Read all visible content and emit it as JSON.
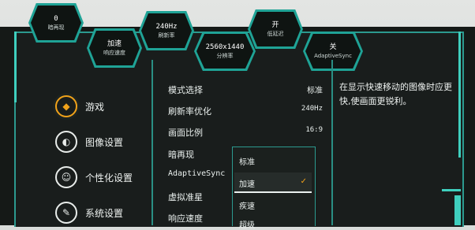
{
  "badges": [
    {
      "value": "0",
      "label": "暗再现"
    },
    {
      "value": "加速",
      "label": "响应速度"
    },
    {
      "value": "240Hz",
      "label": "刷新率"
    },
    {
      "value": "2560x1440",
      "label": "分辨率"
    },
    {
      "value": "开",
      "label": "低延迟"
    },
    {
      "value": "关",
      "label": "AdaptiveSync"
    }
  ],
  "nav": [
    {
      "label": "游戏",
      "icon": "game-icon"
    },
    {
      "label": "图像设置",
      "icon": "image-icon"
    },
    {
      "label": "个性化设置",
      "icon": "robot-icon"
    },
    {
      "label": "系统设置",
      "icon": "wrench-icon"
    }
  ],
  "settings": [
    {
      "label": "模式选择",
      "value": "标准"
    },
    {
      "label": "刷新率优化",
      "value": "240Hz"
    },
    {
      "label": "画面比例",
      "value": "16:9"
    },
    {
      "label": "暗再现",
      "value": ""
    },
    {
      "label": "AdaptiveSync",
      "value": ""
    },
    {
      "label": "虚拟准星",
      "value": ""
    },
    {
      "label": "响应速度",
      "value": ""
    }
  ],
  "dropdown": {
    "options": [
      "标准",
      "加速",
      "疾速",
      "超级"
    ],
    "selected": "加速",
    "check": "✓"
  },
  "description": "在显示快速移动的图像时应更快,使画面更锐利。",
  "colors": {
    "accent": "#2c9a8f",
    "highlight": "#f0a21a"
  }
}
